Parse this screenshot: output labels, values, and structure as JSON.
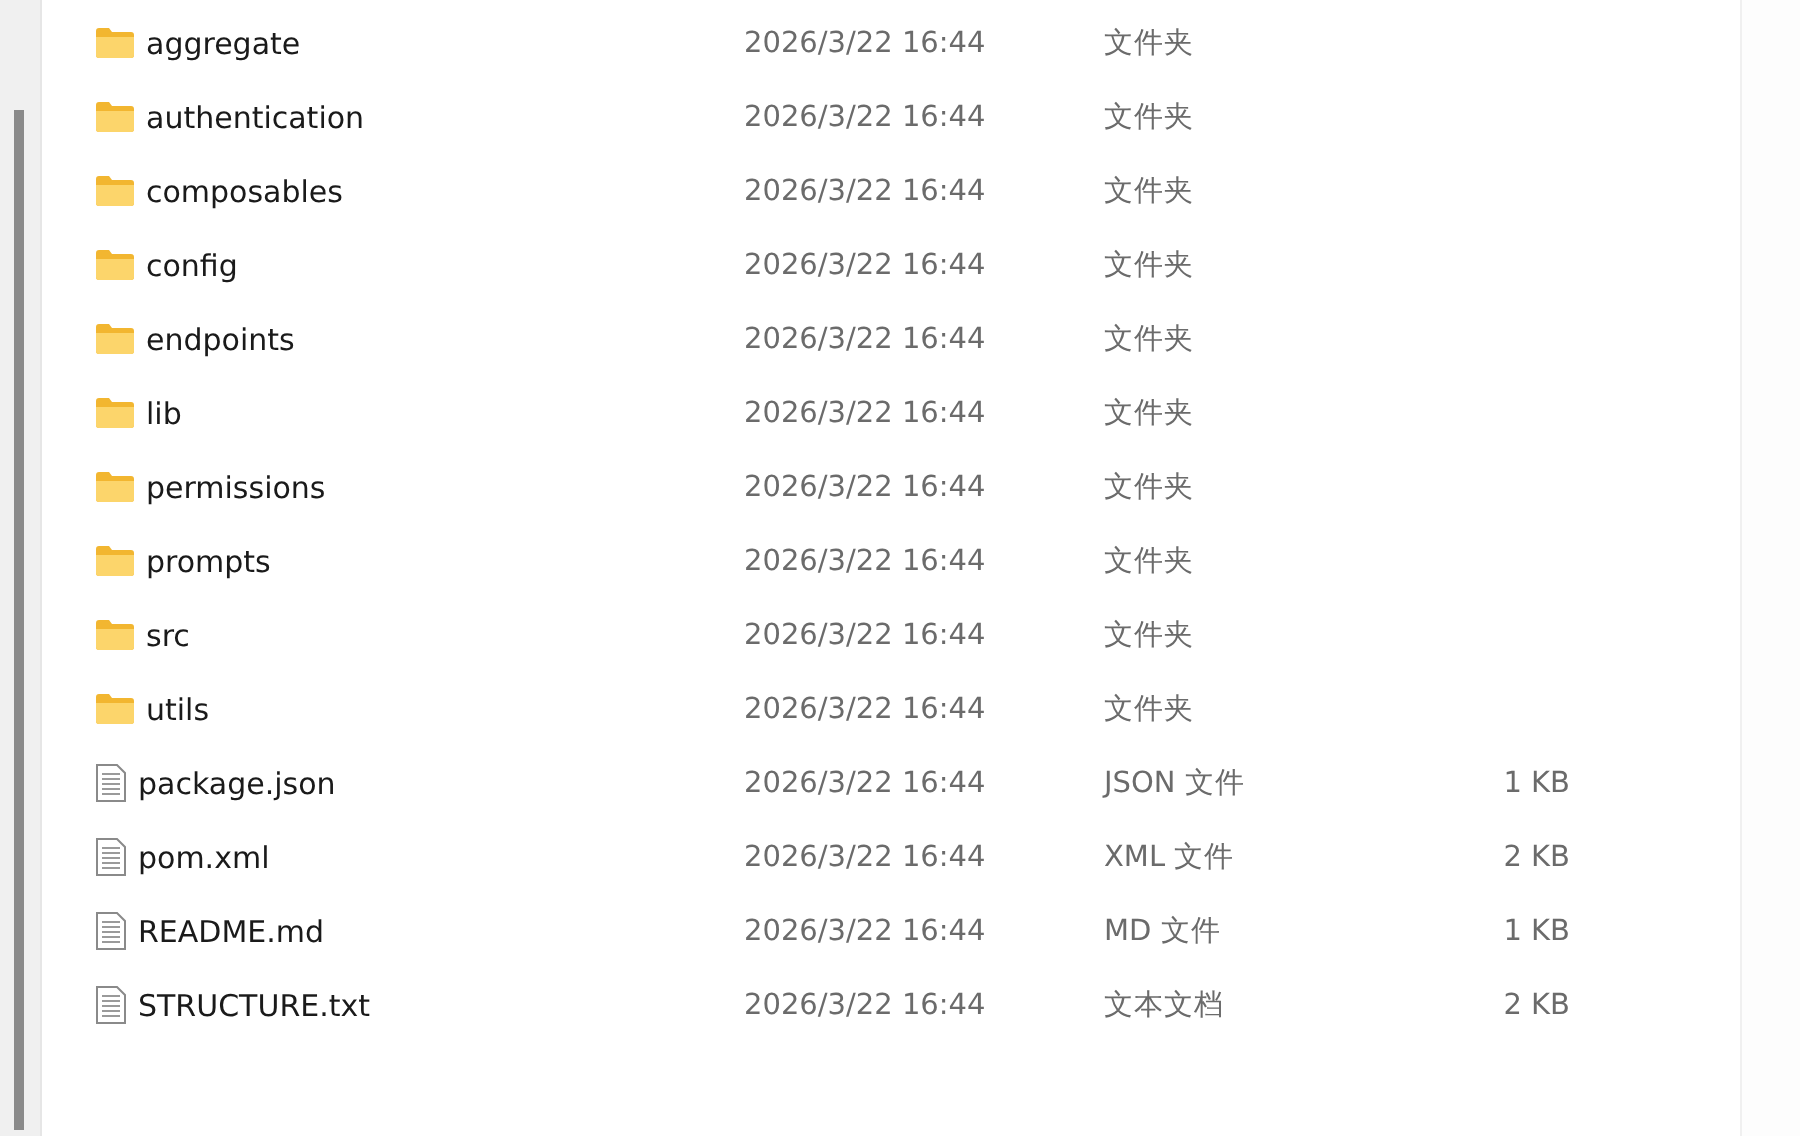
{
  "files": [
    {
      "kind": "folder",
      "name": "aggregate",
      "modified": "2026/3/22 16:44",
      "type": "文件夹"
    },
    {
      "kind": "folder",
      "name": "authentication",
      "modified": "2026/3/22 16:44",
      "type": "文件夹"
    },
    {
      "kind": "folder",
      "name": "composables",
      "modified": "2026/3/22 16:44",
      "type": "文件夹"
    },
    {
      "kind": "folder",
      "name": "config",
      "modified": "2026/3/22 16:44",
      "type": "文件夹"
    },
    {
      "kind": "folder",
      "name": "endpoints",
      "modified": "2026/3/22 16:44",
      "type": "文件夹"
    },
    {
      "kind": "folder",
      "name": "lib",
      "modified": "2026/3/22 16:44",
      "type": "文件夹"
    },
    {
      "kind": "folder",
      "name": "permissions",
      "modified": "2026/3/22 16:44",
      "type": "文件夹"
    },
    {
      "kind": "folder",
      "name": "prompts",
      "modified": "2026/3/22 16:44",
      "type": "文件夹"
    },
    {
      "kind": "folder",
      "name": "src",
      "modified": "2026/3/22 16:44",
      "type": "文件夹"
    },
    {
      "kind": "folder",
      "name": "utils",
      "modified": "2026/3/22 16:44",
      "type": "文件夹"
    },
    {
      "kind": "file",
      "name": "package.json",
      "modified": "2026/3/22 16:44",
      "type": "JSON 文件",
      "size": "1 KB"
    },
    {
      "kind": "file",
      "name": "pom.xml",
      "modified": "2026/3/22 16:44",
      "type": "XML 文件",
      "size": "2 KB"
    },
    {
      "kind": "file",
      "name": "README.md",
      "modified": "2026/3/22 16:44",
      "type": "MD 文件",
      "size": "1 KB"
    },
    {
      "kind": "file",
      "name": "STRUCTURE.txt",
      "modified": "2026/3/22 16:44",
      "type": "文本文档",
      "size": "2 KB"
    }
  ]
}
